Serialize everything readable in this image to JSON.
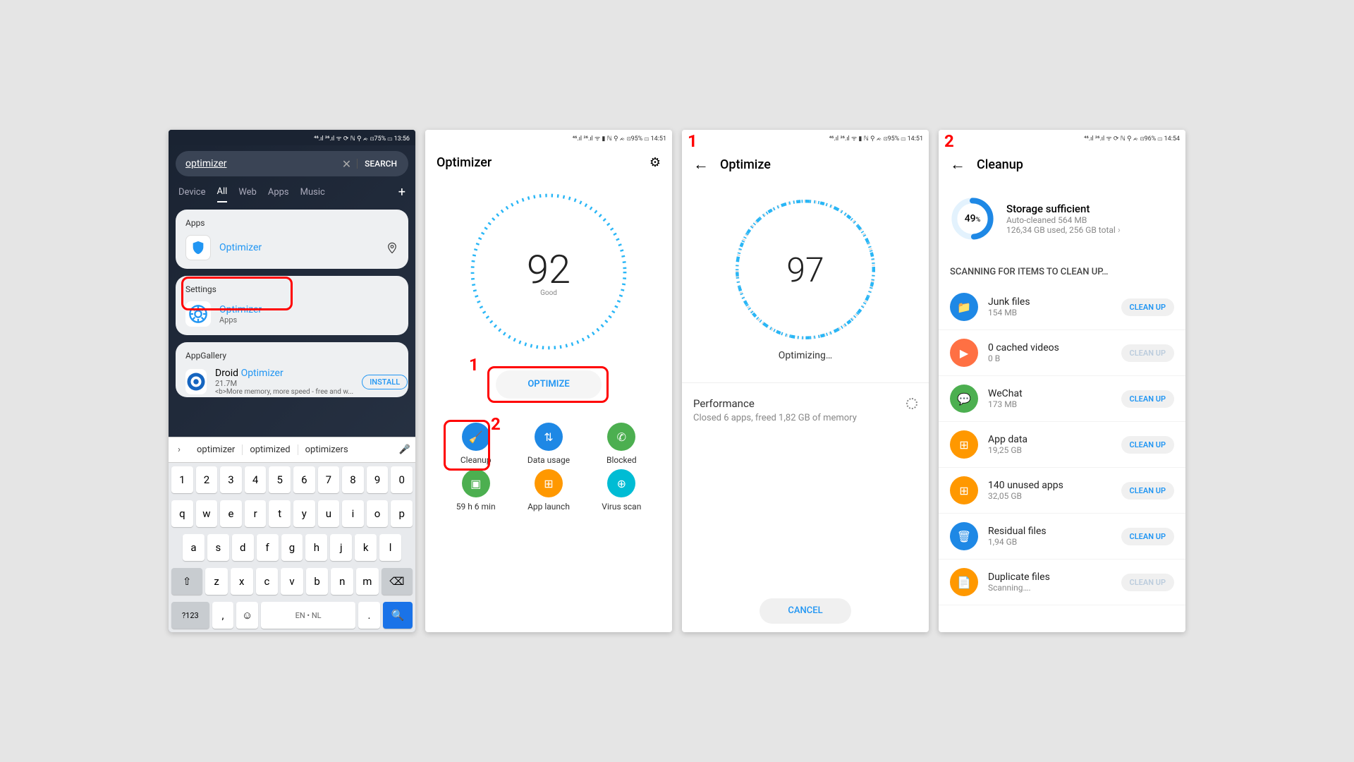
{
  "screens": {
    "s1": {
      "status": {
        "right": "⁴⁶.ıl ³⁶.ıl ᯤ ⟳ ℕ ⚲ ᨃ ⊡75% ▭ 13:56"
      },
      "search": {
        "value": "optimizer",
        "clear": "✕",
        "button": "SEARCH"
      },
      "tabs": [
        "Device",
        "All",
        "Web",
        "Apps",
        "Music"
      ],
      "activeTab": "All",
      "apps": {
        "title": "Apps",
        "item": {
          "name": "Optimizer",
          "locationIcon": "◎"
        }
      },
      "settings": {
        "title": "Settings",
        "item": {
          "name": "Optimizer",
          "sub": "Apps"
        }
      },
      "gallery": {
        "title": "AppGallery",
        "item": {
          "name_pre": "Droid ",
          "name_link": "Optimizer",
          "downloads": "21.7M",
          "desc": "<b>More memory, more speed - free and w...",
          "action": "INSTALL"
        }
      },
      "suggestions": [
        "optimizer",
        "optimized",
        "optimizers"
      ],
      "keyboard": {
        "row1": [
          "1",
          "2",
          "3",
          "4",
          "5",
          "6",
          "7",
          "8",
          "9",
          "0"
        ],
        "row2": [
          "q",
          "w",
          "e",
          "r",
          "t",
          "y",
          "u",
          "i",
          "o",
          "p"
        ],
        "row3": [
          "a",
          "s",
          "d",
          "f",
          "g",
          "h",
          "j",
          "k",
          "l"
        ],
        "row4": [
          "⇧",
          "z",
          "x",
          "c",
          "v",
          "b",
          "n",
          "m",
          "⌫"
        ],
        "row5": {
          "sym": "?123",
          "comma": ",",
          "emoji": "☺",
          "space": "EN • NL",
          "dot": ".",
          "search": "🔍"
        }
      }
    },
    "s2": {
      "status": {
        "right": "⁴⁶.ıl ³⁶.ıl ᯤ ▮ ℕ ⚲ ᨃ ⊡95% ▭ 14:51"
      },
      "title": "Optimizer",
      "score": "92",
      "scoreLabel": "Good",
      "button": "OPTIMIZE",
      "badge1": "1",
      "badge2": "2",
      "tools": [
        {
          "label": "Cleanup",
          "color": "#1e88e5",
          "glyph": "🧹"
        },
        {
          "label": "Data usage",
          "color": "#1e88e5",
          "glyph": "⇅"
        },
        {
          "label": "Blocked",
          "color": "#4caf50",
          "glyph": "✆"
        },
        {
          "label": "59 h 6 min",
          "color": "#4caf50",
          "glyph": "▣"
        },
        {
          "label": "App launch",
          "color": "#ff9800",
          "glyph": "⊞"
        },
        {
          "label": "Virus scan",
          "color": "#00bcd4",
          "glyph": "⊕"
        }
      ]
    },
    "s3": {
      "badge": "1",
      "status": {
        "right": "⁴⁶.ıl ³⁶.ıl ᯤ ▮ ℕ ⚲ ᨃ ⊡95% ▭ 14:51"
      },
      "title": "Optimize",
      "score": "97",
      "status_text": "Optimizing…",
      "perf": {
        "title": "Performance",
        "sub": "Closed 6 apps, freed 1,82 GB of memory"
      },
      "cancel": "CANCEL"
    },
    "s4": {
      "badge": "2",
      "status": {
        "right": "⁴⁶.ıl ³⁶.ıl ᯤ ⟳ ℕ ⚲ ᨃ ⊡96% ▭ 14:54"
      },
      "title": "Cleanup",
      "storage": {
        "pct": "49",
        "pctSuffix": "%",
        "title": "Storage sufficient",
        "sub1": "Auto-cleaned 564 MB",
        "sub2": "126,34 GB used, 256 GB total"
      },
      "scanTitle": "SCANNING FOR ITEMS TO CLEAN UP…",
      "items": [
        {
          "name": "Junk files",
          "size": "154 MB",
          "color": "#1e88e5",
          "glyph": "📁",
          "action": "CLEAN UP",
          "enabled": true
        },
        {
          "name": "0 cached videos",
          "size": "0 B",
          "color": "#ff7043",
          "glyph": "▶",
          "action": "CLEAN UP",
          "enabled": false
        },
        {
          "name": "WeChat",
          "size": "173 MB",
          "color": "#4caf50",
          "glyph": "💬",
          "action": "CLEAN UP",
          "enabled": true
        },
        {
          "name": "App data",
          "size": "19,25 GB",
          "color": "#ff9800",
          "glyph": "⊞",
          "action": "CLEAN UP",
          "enabled": true
        },
        {
          "name": "140 unused apps",
          "size": "32,05 GB",
          "color": "#ff9800",
          "glyph": "⊞",
          "action": "CLEAN UP",
          "enabled": true
        },
        {
          "name": "Residual files",
          "size": "1,94 GB",
          "color": "#1e88e5",
          "glyph": "🗑",
          "action": "CLEAN UP",
          "enabled": true
        },
        {
          "name": "Duplicate files",
          "size": "Scanning….",
          "color": "#ff9800",
          "glyph": "📄",
          "action": "CLEAN UP",
          "enabled": false
        }
      ]
    }
  }
}
